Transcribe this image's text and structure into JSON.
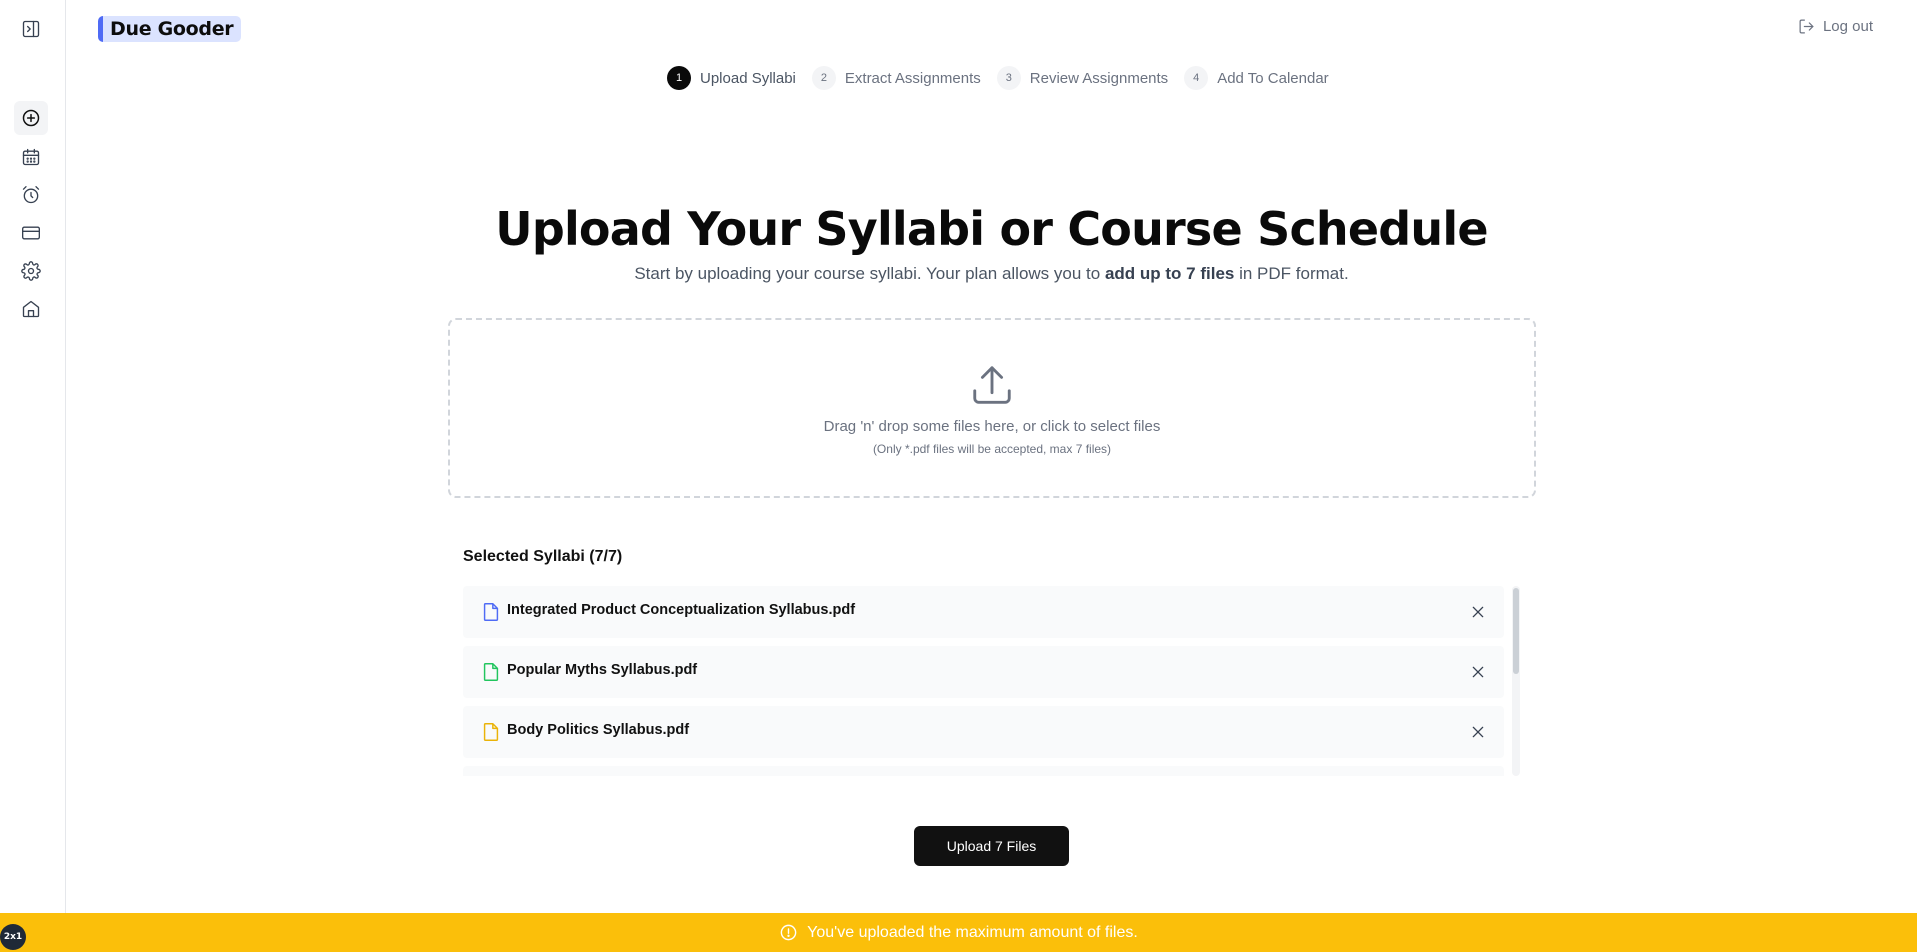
{
  "app": {
    "title": "Due Gooder"
  },
  "header": {
    "logout_label": "Log out"
  },
  "sidebar": {
    "items": [
      {
        "name": "toggle-sidebar",
        "icon": "sidebar-toggle-icon"
      },
      {
        "name": "new-upload",
        "icon": "plus-circle-icon"
      },
      {
        "name": "calendar",
        "icon": "calendar-icon"
      },
      {
        "name": "reminders",
        "icon": "alarm-clock-icon"
      },
      {
        "name": "billing",
        "icon": "credit-card-icon"
      },
      {
        "name": "settings",
        "icon": "gear-icon"
      },
      {
        "name": "home",
        "icon": "home-icon"
      }
    ]
  },
  "stepper": {
    "steps": [
      {
        "num": "1",
        "label": "Upload Syllabi",
        "active": true
      },
      {
        "num": "2",
        "label": "Extract Assignments",
        "active": false
      },
      {
        "num": "3",
        "label": "Review Assignments",
        "active": false
      },
      {
        "num": "4",
        "label": "Add To Calendar",
        "active": false
      }
    ]
  },
  "main": {
    "title": "Upload Your Syllabi or Course Schedule",
    "subtitle_before": "Start by uploading your course syllabi. Your plan allows you to ",
    "subtitle_bold": "add up to 7 files",
    "subtitle_after": " in PDF format."
  },
  "dropzone": {
    "main_text": "Drag 'n' drop some files here, or click to select files",
    "sub_text": "(Only *.pdf files will be accepted, max 7 files)"
  },
  "selected": {
    "title": "Selected Syllabi (7/7)",
    "files": [
      {
        "name": "Integrated Product Conceptualization Syllabus.pdf",
        "color": "#4f6bf5"
      },
      {
        "name": "Popular Myths Syllabus.pdf",
        "color": "#22c55e"
      },
      {
        "name": "Body Politics Syllabus.pdf",
        "color": "#eab308"
      }
    ]
  },
  "upload_button": {
    "label": "Upload 7 Files"
  },
  "banner": {
    "message": "You've uploaded the maximum amount of files.",
    "color": "#fbbf0a"
  },
  "badge": {
    "label": "2x1"
  }
}
